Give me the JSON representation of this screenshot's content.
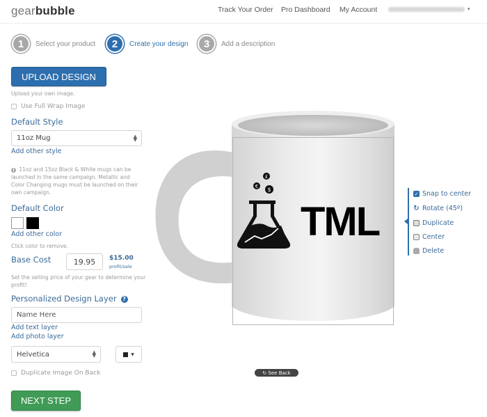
{
  "header": {
    "logo_light": "gear",
    "logo_bold": "bubble",
    "nav": [
      "Track Your Order",
      "Pro Dashboard",
      "My Account"
    ],
    "user_menu_caret": "▾"
  },
  "steps": [
    {
      "number": "1",
      "label": "Select your product",
      "active": false
    },
    {
      "number": "2",
      "label": "Create your design",
      "active": true
    },
    {
      "number": "3",
      "label": "Add a description",
      "active": false
    }
  ],
  "left_panel": {
    "upload_button": "UPLOAD DESIGN",
    "upload_hint": "Upload your own image.",
    "full_wrap_label": "Use Full Wrap Image",
    "default_style_title": "Default Style",
    "style_select_value": "11oz Mug",
    "add_style_link": "Add other style",
    "info_icon": "i",
    "style_info": "11oz and 15oz Black & White mugs can be launched in the same campaign. Metallic and Color Changing mugs must be launched on their own campaign.",
    "default_color_title": "Default Color",
    "colors": [
      "#ffffff",
      "#000000"
    ],
    "add_color_link": "Add other color",
    "color_hint": "Click color to remove.",
    "base_cost_label": "Base Cost",
    "base_cost_value": "19.95",
    "profit_value": "$15.00",
    "profit_unit": "profit/sale",
    "price_hint": "Set the selling price of your gear to determine your profit!",
    "personalized_title": "Personalized Design Layer",
    "help_icon": "?",
    "name_field_value": "Name Here",
    "add_text_link": "Add text layer",
    "add_photo_link": "Add photo layer",
    "font_select_value": "Helvetica",
    "text_color": "#222222",
    "duplicate_back_label": "Duplicate Image On Back",
    "next_button": "NEXT STEP"
  },
  "preview": {
    "design_text": "TML",
    "bubbles": [
      "£",
      "€",
      "$"
    ],
    "see_back_label": "See Back"
  },
  "tools": {
    "snap_label": "Snap to center",
    "rotate_label": "Rotate (45º)",
    "duplicate_label": "Duplicate",
    "center_label": "Center",
    "delete_label": "Delete"
  },
  "colors": {
    "primary_blue": "#2d6fae",
    "link_blue": "#3a6a98",
    "next_green": "#3f9b55",
    "step_gray": "#a8a8a8"
  }
}
